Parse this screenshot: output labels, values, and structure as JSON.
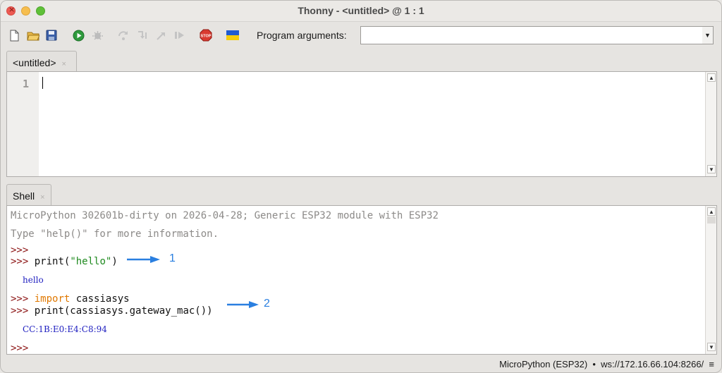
{
  "window": {
    "title": "Thonny  -  <untitled>  @  1 : 1"
  },
  "toolbar": {
    "icons": [
      "new-file-icon",
      "open-folder-icon",
      "save-icon",
      "run-icon",
      "debug-icon",
      "step-over-icon",
      "step-into-icon",
      "step-out-icon",
      "resume-icon",
      "stop-icon",
      "ukraine-flag-icon"
    ],
    "program_arguments_label": "Program arguments:",
    "program_arguments_value": ""
  },
  "editor": {
    "tab_label": "<untitled>",
    "tab_close": "×",
    "line_number": "1"
  },
  "shell": {
    "tab_label": "Shell",
    "tab_close": "×",
    "banner_line1": "MicroPython 302601b-dirty on 2026-04-28; Generic ESP32 module with ESP32",
    "banner_line2": "Type \"help()\" for more information.",
    "prompt": ">>>",
    "cmd1_fn": "print(",
    "cmd1_str": "\"hello\"",
    "cmd1_end": ")",
    "out1": "hello",
    "cmd2_kw": "import",
    "cmd2_rest": " cassiasys",
    "cmd3": "print(cassiasys.gateway_mac())",
    "out2": "CC:1B:E0:E4:C8:94",
    "annotation1": "1",
    "annotation2": "2"
  },
  "status": {
    "text": "MicroPython (ESP32)  •  ws://172.16.66.104:8266/",
    "menu_glyph": "≡"
  },
  "colors": {
    "prompt": "#8b1212",
    "string": "#1f8a1f",
    "keyword": "#e07800",
    "output": "#2020c0",
    "annotation": "#2a7fe0"
  }
}
